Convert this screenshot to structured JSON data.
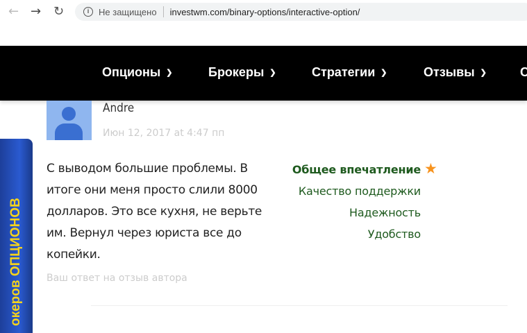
{
  "browser": {
    "security_label": "Не защищено",
    "url": "investwm.com/binary-options/interactive-option/"
  },
  "nav": {
    "items": [
      "Опционы",
      "Брокеры",
      "Стратегии",
      "Отзывы",
      "С"
    ]
  },
  "side_tab": {
    "label": "океров ОПЦИОНОВ"
  },
  "review": {
    "author": "Andre",
    "date": "Июн 12, 2017 at 4:47 пп",
    "text": "С выводом большие проблемы. В итоге они меня просто слили 8000 долларов. Это все кухня, не верьте им. Вернул через юриста все до копейки.",
    "reply_link": "Ваш ответ на отзыв автора",
    "ratings": [
      "Общее впечатление",
      "Качество поддержки",
      "Надежность",
      "Удобство"
    ],
    "star_color": "#f7931e"
  }
}
